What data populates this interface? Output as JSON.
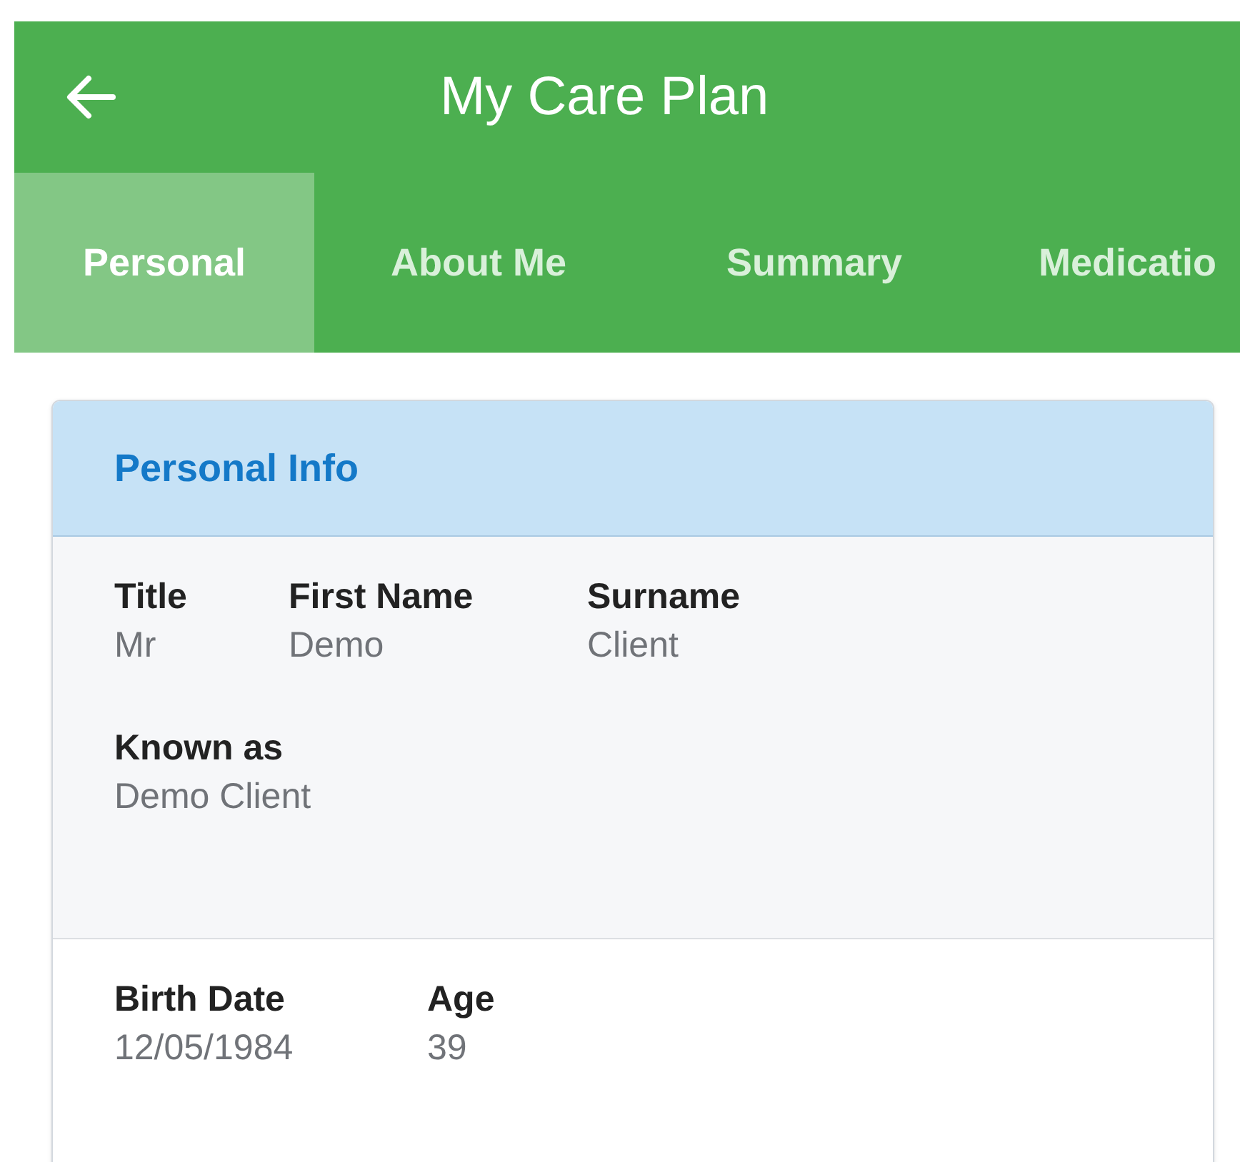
{
  "app_bar": {
    "title": "My Care Plan"
  },
  "tabs": [
    {
      "label": "Personal",
      "selected": true
    },
    {
      "label": "About Me",
      "selected": false
    },
    {
      "label": "Summary",
      "selected": false
    },
    {
      "label": "Medicatio",
      "selected": false
    }
  ],
  "card": {
    "title": "Personal Info",
    "sections": [
      {
        "kind": "shaded",
        "rows": [
          [
            {
              "label": "Title",
              "value": "Mr"
            },
            {
              "label": "First Name",
              "value": "Demo"
            },
            {
              "label": "Surname",
              "value": "Client"
            }
          ],
          [
            {
              "label": "Known as",
              "value": "Demo Client"
            }
          ]
        ]
      },
      {
        "kind": "plain",
        "rows": [
          [
            {
              "label": "Birth Date",
              "value": "12/05/1984"
            },
            {
              "label": "Age",
              "value": "39"
            }
          ]
        ]
      }
    ]
  }
}
